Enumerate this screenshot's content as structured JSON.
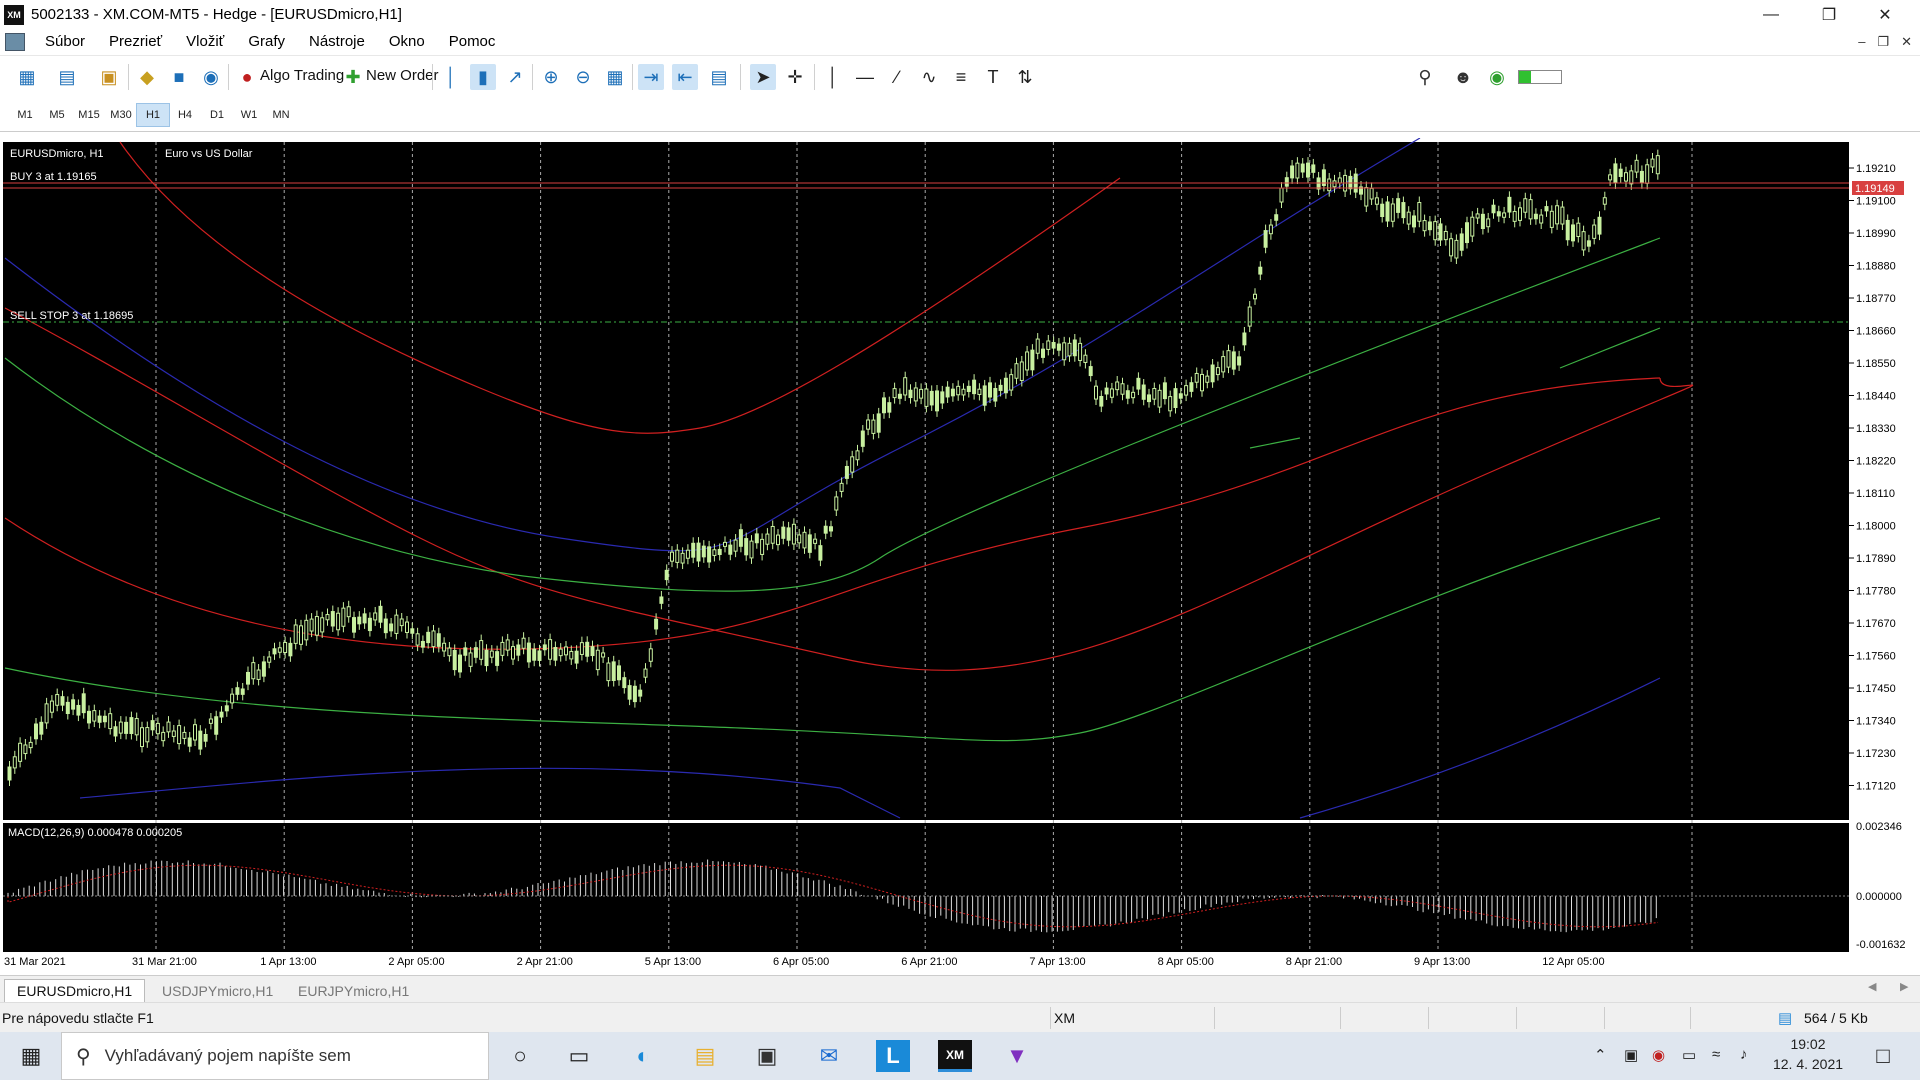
{
  "window": {
    "title": "5002133 - XM.COM-MT5 - Hedge - [EURUSDmicro,H1]",
    "logo": "XM",
    "controls": [
      "minimize-icon",
      "restore-icon",
      "close-icon"
    ]
  },
  "menu": {
    "items": [
      "Súbor",
      "Prezrieť",
      "Vložiť",
      "Grafy",
      "Nástroje",
      "Okno",
      "Pomoc"
    ]
  },
  "toolbar": {
    "algo_trading_label": "Algo Trading",
    "new_order_label": "New Order"
  },
  "timeframes": {
    "items": [
      "M1",
      "M5",
      "M15",
      "M30",
      "H1",
      "H4",
      "D1",
      "W1",
      "MN"
    ],
    "active": "H1"
  },
  "chart": {
    "symbol_label": "EURUSDmicro, H1",
    "description": "Euro vs US Dollar",
    "buy_order_label": "BUY 3 at 1.19165",
    "sell_stop_label": "SELL STOP 3 at 1.18695",
    "current_price_label": "1.19149",
    "price_axis": [
      "1.19210",
      "1.19100",
      "1.18990",
      "1.18880",
      "1.18770",
      "1.18660",
      "1.18550",
      "1.18440",
      "1.18330",
      "1.18220",
      "1.18110",
      "1.18000",
      "1.17890",
      "1.17780",
      "1.17670",
      "1.17560",
      "1.17450",
      "1.17340",
      "1.17230",
      "1.17120"
    ],
    "macd_label": "MACD(12,26,9) 0.000478 0.000205",
    "macd_axis": [
      "0.002346",
      "0.000000",
      "-0.001632"
    ],
    "time_axis": [
      "31 Mar 2021",
      "31 Mar 21:00",
      "1 Apr 13:00",
      "2 Apr 05:00",
      "2 Apr 21:00",
      "5 Apr 13:00",
      "6 Apr 05:00",
      "6 Apr 21:00",
      "7 Apr 13:00",
      "8 Apr 05:00",
      "8 Apr 21:00",
      "9 Apr 13:00",
      "12 Apr 05:00"
    ],
    "colors": {
      "background": "#000000",
      "bull_candle": "#c8f0a0",
      "grid": "#c0c0c0",
      "order_line": "#d84040",
      "sell_stop_line": "#3cb043",
      "ma_red": "#d02020",
      "ma_green": "#3cb043",
      "ma_blue": "#2a2ab0"
    }
  },
  "symbol_tabs": {
    "items": [
      "EURUSDmicro,H1",
      "USDJPYmicro,H1",
      "EURJPYmicro,H1"
    ],
    "active": "EURUSDmicro,H1"
  },
  "status": {
    "help_text": "Pre nápovedu stlačte F1",
    "profile": "XM",
    "traffic": "564 / 5 Kb"
  },
  "taskbar": {
    "search_placeholder": "Vyhľadávaný pojem napíšte sem",
    "time": "19:02",
    "date": "12. 4. 2021"
  }
}
